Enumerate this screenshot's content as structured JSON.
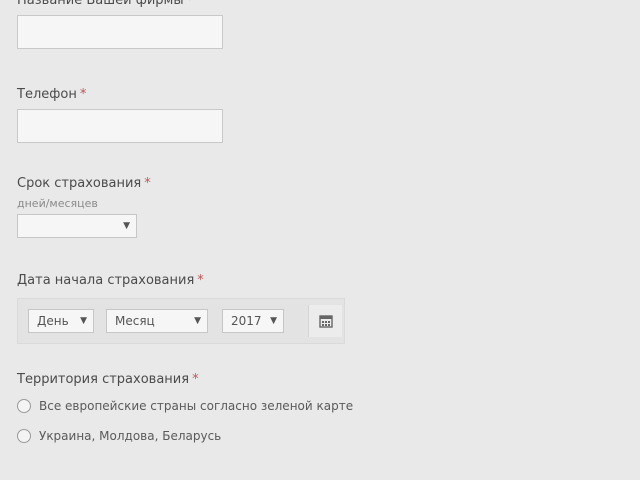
{
  "form": {
    "company": {
      "label": "Название Вашей фирмы",
      "required_mark": "*",
      "value": ""
    },
    "phone": {
      "label": "Телефон",
      "required_mark": "*",
      "value": ""
    },
    "term": {
      "label": "Срок страхования",
      "required_mark": "*",
      "hint": "дней/месяцев",
      "selected": ""
    },
    "start_date": {
      "label": "Дата начала страхования",
      "required_mark": "*",
      "day": "День",
      "month": "Месяц",
      "year": "2017"
    },
    "territory": {
      "label": "Территория страхования",
      "required_mark": "*",
      "options": [
        "Все европейские страны согласно зеленой карте",
        "Украина, Молдова, Беларусь"
      ]
    }
  }
}
